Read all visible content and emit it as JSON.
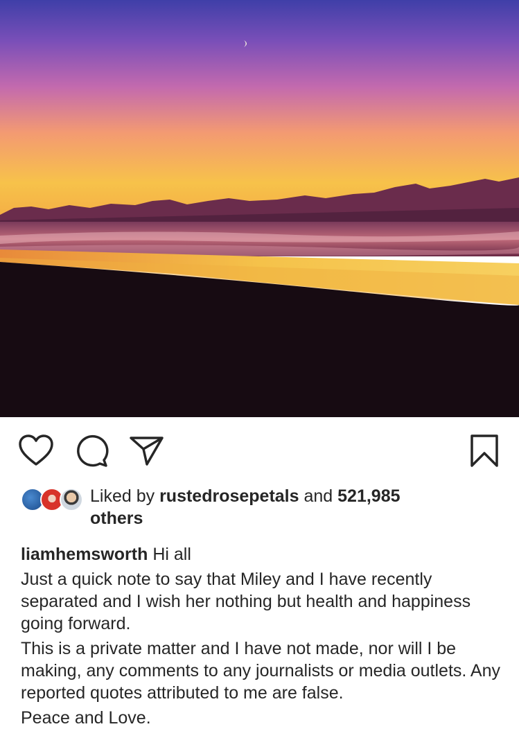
{
  "post": {
    "image_alt": "Sunset over a beach with mountains",
    "colors": {
      "sky_top": "#4a3fb0",
      "sky_mid": "#c06fb0",
      "sky_horizon": "#f5b040",
      "mountains": "#5a2a4a",
      "sand": "#1a0d14"
    }
  },
  "actions": {
    "like_icon": "heart-icon",
    "comment_icon": "comment-icon",
    "share_icon": "send-icon",
    "save_icon": "bookmark-icon"
  },
  "likes": {
    "prefix": "Liked by ",
    "liked_by_user": "rustedrosepetals",
    "middle": " and ",
    "count": "521,985",
    "suffix": "others"
  },
  "caption": {
    "username": "liamhemsworth",
    "first_line": "Hi all",
    "paragraph1": "Just a quick note to say that Miley and I have recently separated and I wish her nothing but health and happiness going forward.",
    "paragraph2": "This is a private matter and I have not made, nor will I be making, any comments to any journalists or media outlets.  Any reported quotes attributed to me are false.",
    "paragraph3": "Peace and Love."
  }
}
